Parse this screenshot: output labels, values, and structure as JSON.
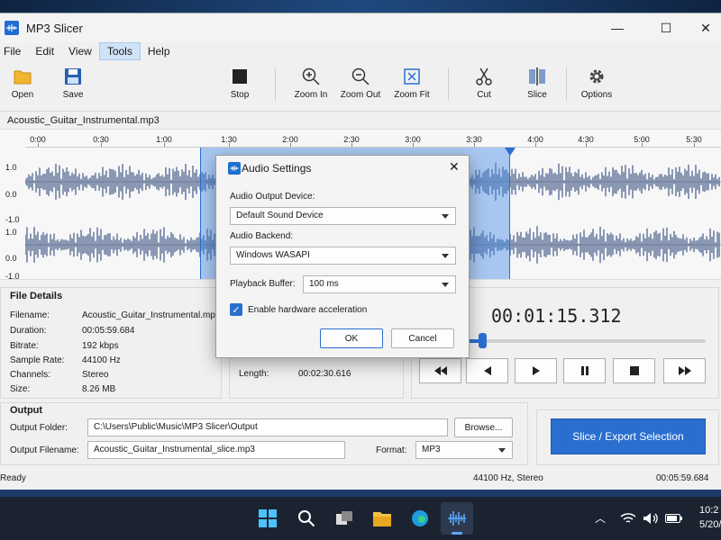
{
  "window": {
    "title": "MP3 Slicer",
    "minimize_glyph": "—",
    "maximize_glyph": "☐",
    "close_glyph": "✕"
  },
  "menu": [
    "File",
    "Edit",
    "View",
    "Tools",
    "Help"
  ],
  "toolbar": {
    "open": "Open",
    "save": "Save",
    "stop": "Stop",
    "zoom_in": "Zoom In",
    "zoom_out": "Zoom Out",
    "zoom_fit": "Zoom Fit",
    "cut": "Cut",
    "slice": "Slice",
    "options": "Options"
  },
  "waveform": {
    "file": "Acoustic_Guitar_Instrumental.mp3",
    "ticks": [
      "0:00",
      "0:30",
      "1:00",
      "1:30",
      "2:00",
      "2:30",
      "3:00",
      "3:30",
      "4:00",
      "4:30",
      "5:00",
      "5:30"
    ],
    "ylabels": [
      "1.0",
      "0.0",
      "-1.0",
      "1.0",
      "0.0",
      "-1.0"
    ],
    "selection_start_fraction": 0.258,
    "selection_end_fraction": 0.704
  },
  "file_details": {
    "header": "File Details",
    "rows": [
      {
        "label": "Filename:",
        "value": "Acoustic_Guitar_Instrumental.mp3"
      },
      {
        "label": "Duration:",
        "value": "00:05:59.684"
      },
      {
        "label": "Bitrate:",
        "value": "192 kbps"
      },
      {
        "label": "Sample Rate:",
        "value": "44100 Hz"
      },
      {
        "label": "Channels:",
        "value": "Stereo"
      },
      {
        "label": "Size:",
        "value": "8.26 MB"
      }
    ]
  },
  "selection": {
    "length_label": "Length:",
    "length_value": "00:02:30.616"
  },
  "player": {
    "time": "00:01:15.312",
    "position_fraction": 0.22
  },
  "output": {
    "header": "Output",
    "folder_label": "Output Folder:",
    "folder_value": "C:\\Users\\Public\\Music\\MP3 Slicer\\Output",
    "browse": "Browse...",
    "filename_label": "Output Filename:",
    "filename_value": "Acoustic_Guitar_Instrumental_slice.mp3",
    "format_label": "Format:",
    "format_value": "MP3",
    "export": "Slice / Export Selection"
  },
  "status": {
    "left": "Ready",
    "middle": "44100 Hz, Stereo",
    "right": "00:05:59.684"
  },
  "dialog": {
    "title": "Audio Settings",
    "device_label": "Audio Output Device:",
    "device_value": "Default Sound Device",
    "backend_label": "Audio Backend:",
    "backend_value": "Windows WASAPI",
    "buffer_label": "Playback Buffer:",
    "buffer_value": "100 ms",
    "hw_accel_label": "Enable hardware acceleration",
    "hw_accel_checked": true,
    "ok": "OK",
    "cancel": "Cancel"
  },
  "taskbar": {
    "clock_time": "10:2",
    "clock_date": "5/20/"
  },
  "colors": {
    "accent": "#2a6fd0",
    "waveform": "#5b6f96",
    "selection": "#4a8ce6"
  }
}
